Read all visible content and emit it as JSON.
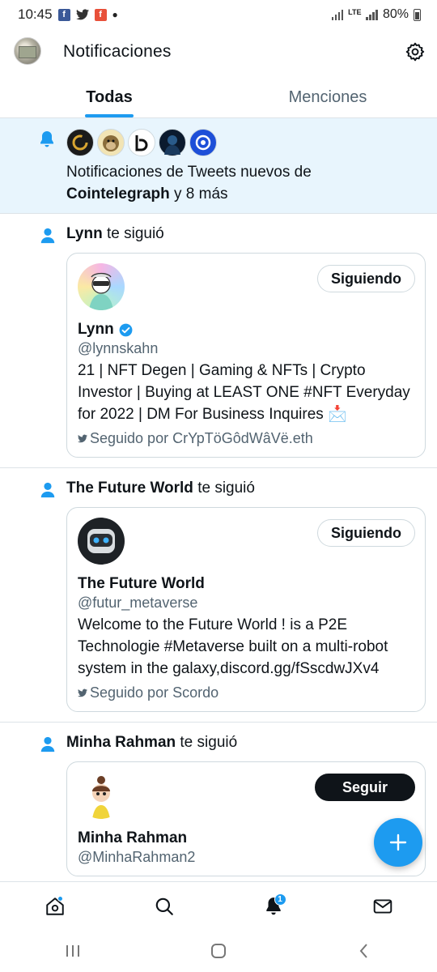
{
  "status_bar": {
    "time": "10:45",
    "network": "LTE",
    "battery": "80%"
  },
  "header": {
    "title": "Notificaciones"
  },
  "tabs": [
    {
      "label": "Todas",
      "active": true
    },
    {
      "label": "Menciones",
      "active": false
    }
  ],
  "banner": {
    "text_prefix": "Notificaciones de Tweets nuevos de",
    "account": "Cointelegraph",
    "suffix": "y 8 más",
    "avatars": [
      "c-logo",
      "ape-avatar",
      "b-logo",
      "hooded-figure",
      "circle-logo"
    ]
  },
  "notifications": [
    {
      "actor": "Lynn",
      "action": "te siguió",
      "card": {
        "name": "Lynn",
        "verified": true,
        "handle": "@lynnskahn",
        "bio": "21 | NFT Degen | Gaming & NFTs | Crypto Investor | Buying at LEAST ONE #NFT Everyday for 2022 | DM For Business Inquires 📩",
        "followed_by": "Seguido por CrYpTöGôdWâVë.eth",
        "button": "Siguiendo"
      }
    },
    {
      "actor": "The Future World",
      "action": "te siguió",
      "card": {
        "name": "The Future World",
        "verified": false,
        "handle": "@futur_metaverse",
        "bio": "Welcome to the Future World ! is a P2E Technologie #Metaverse built on a multi-robot system in the galaxy,discord.gg/fSscdwJXv4",
        "followed_by": "Seguido por Scordo",
        "button": "Siguiendo"
      }
    },
    {
      "actor": "Minha Rahman",
      "action": "te siguió",
      "card": {
        "name": "Minha Rahman",
        "verified": false,
        "handle": "@MinhaRahman2",
        "followed_by": "",
        "button": "Seguir"
      }
    }
  ],
  "bottom_nav": {
    "notifications_badge": "1"
  },
  "colors": {
    "accent": "#1d9bf0",
    "text": "#0f1419",
    "muted": "#536471",
    "banner_bg": "#e8f5fd"
  }
}
